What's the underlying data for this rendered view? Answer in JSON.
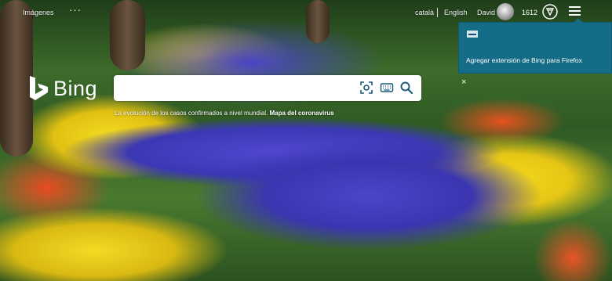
{
  "header": {
    "images_label": "Imágenes",
    "more_label": "···",
    "lang_ca": "català",
    "lang_en": "English",
    "user_name": "David",
    "points": "1612"
  },
  "logo": {
    "text": "Bing"
  },
  "search": {
    "value": "",
    "placeholder": ""
  },
  "trending": {
    "text": "La evolución de los casos confirmados a nivel mundial.",
    "link": "Mapa del coronavirus"
  },
  "popup": {
    "text": "Agregar extensión de Bing para Firefox",
    "close": "×"
  },
  "icons": {
    "visual_search": "visual-search-icon",
    "keyboard": "keyboard-icon",
    "search": "search-icon",
    "rewards": "rewards-icon",
    "menu": "hamburger-menu-icon"
  },
  "colors": {
    "popup_bg": "#156c86",
    "search_icon": "#1a5a7a"
  }
}
